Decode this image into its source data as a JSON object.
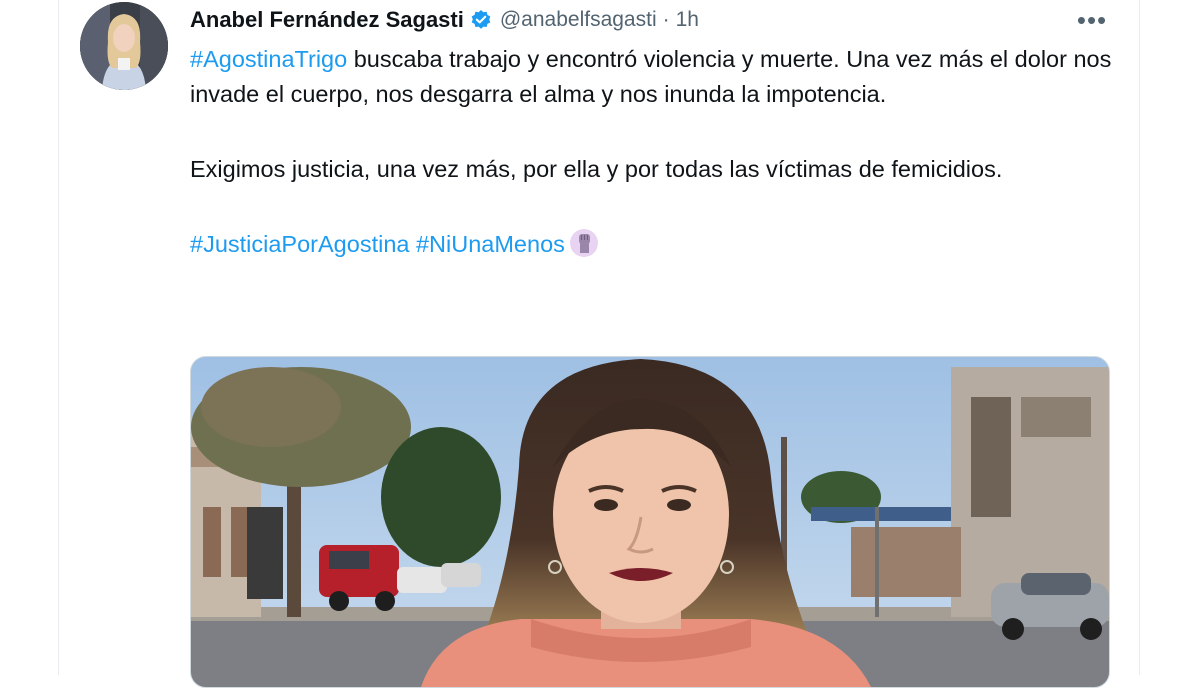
{
  "tweet": {
    "author_name": "Anabel Fernández Sagasti",
    "handle": "@anabelfsagasti",
    "separator": "·",
    "time": "1h",
    "more_label": "•••",
    "line1_hashtag": "#AgostinaTrigo",
    "line1_text": " buscaba trabajo y encontró violencia y muerte. Una vez más el dolor nos invade el cuerpo, nos desgarra el alma y nos inunda la impotencia.",
    "paragraph2": "Exigimos justicia, una vez más, por ella y por todas las víctimas de femicidios.",
    "hashtag2": "#JusticiaPorAgostina",
    "hashtag3": "#NiUnaMenos",
    "emoji": "raised-fist-emoji"
  },
  "colors": {
    "link": "#1d9bf0",
    "secondary_text": "#536471",
    "verified_badge": "#1d9bf0",
    "emoji_bg": "#e8d4f2"
  }
}
